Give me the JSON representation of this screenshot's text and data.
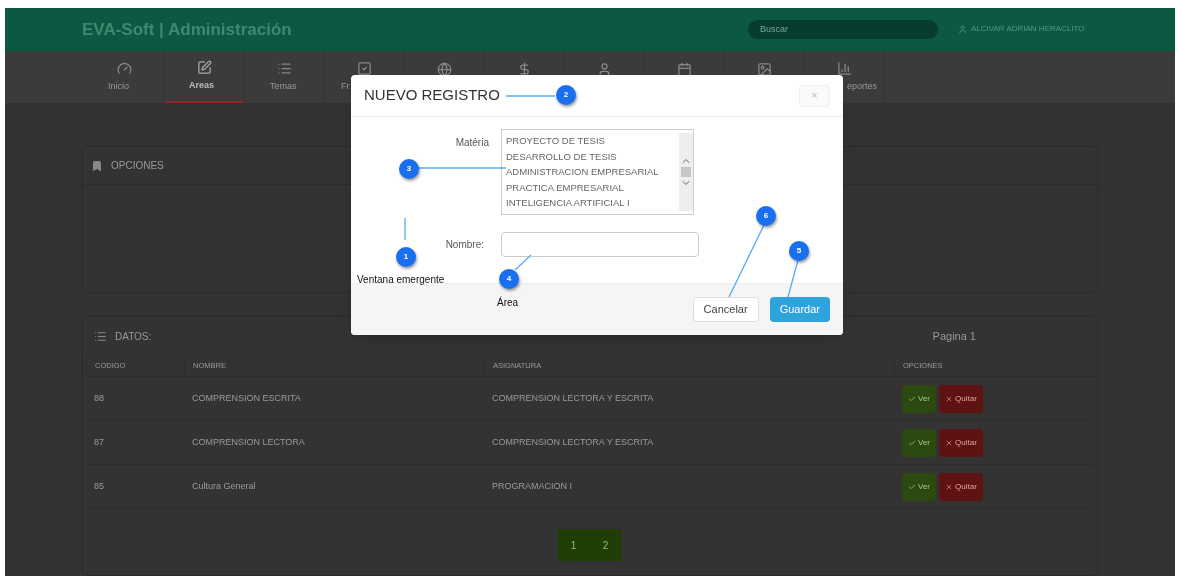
{
  "header": {
    "title": "EVA-Soft | Administración",
    "search": {
      "placeholder": "Buscar"
    },
    "user": "ALCIVAR ADRIAN HERACLITO"
  },
  "nav": [
    {
      "label": "Inicio",
      "selected": false
    },
    {
      "label": "Areas",
      "selected": true
    },
    {
      "label": "Temas",
      "selected": false
    },
    {
      "label": "Fr",
      "selected": false
    },
    {
      "selected": false
    },
    {
      "selected": false
    },
    {
      "selected": false
    },
    {
      "selected": false
    },
    {
      "selected": false
    },
    {
      "label": "eportes",
      "selected": false
    }
  ],
  "options_panel": {
    "title": "OPCIONES"
  },
  "data_panel": {
    "title": "DATOS:",
    "page": "Pagina 1",
    "columns": [
      "CODIGO",
      "NOMBRE",
      "ASIGNATURA",
      "OPCIONES"
    ],
    "rows": [
      {
        "code": "88",
        "name": "COMPRENSION ESCRITA",
        "subject": "COMPRENSION LECTORA Y ESCRITA",
        "actions": [
          "Ver",
          "Quitar"
        ]
      },
      {
        "code": "87",
        "name": "COMPRENSION LECTORA",
        "subject": "COMPRENSION LECTORA Y ESCRITA",
        "actions": [
          "Ver",
          "Quitar"
        ]
      },
      {
        "code": "85",
        "name": "Cultura General",
        "subject": "PROGRAMACION I",
        "actions": [
          "Ver",
          "Quitar"
        ]
      }
    ],
    "pages": [
      "1",
      "2"
    ]
  },
  "modal": {
    "title": "NUEVO REGISTRO",
    "close": "×",
    "subject_label": "Matéria",
    "subjects": [
      "PROYECTO DE TESIS",
      "DESARROLLO DE TESIS",
      "ADMINISTRACION EMPRESARIAL",
      "PRACTICA EMPRESARIAL",
      "INTELIGENCIA ARTIFICIAL I"
    ],
    "name_label": "Nombre:",
    "buttons": [
      "Cancelar",
      "Guardar"
    ]
  },
  "annotations": [
    {
      "number": "1",
      "label": "Ventana emergente"
    },
    {
      "number": "2"
    },
    {
      "number": "3"
    },
    {
      "number": "4",
      "label": "Área"
    },
    {
      "number": "5"
    },
    {
      "number": "6"
    }
  ]
}
